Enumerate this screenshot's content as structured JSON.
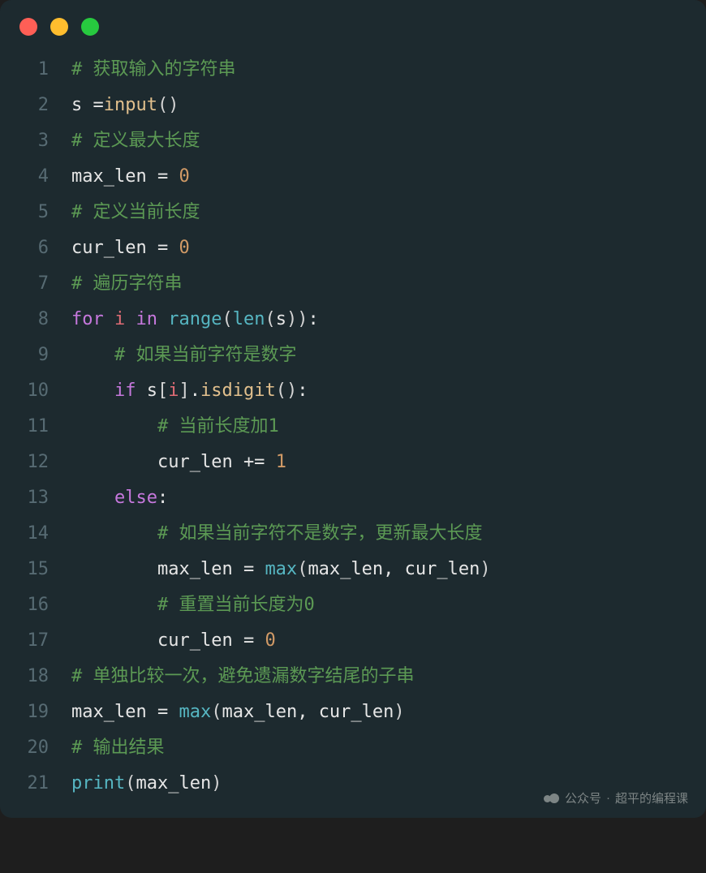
{
  "window": {
    "dots": [
      "red",
      "yellow",
      "green"
    ]
  },
  "watermark": {
    "prefix": "公众号",
    "dot": "·",
    "name": "超平的编程课"
  },
  "code": {
    "lines": [
      {
        "n": "1",
        "tokens": [
          {
            "t": "# 获取输入的字符串",
            "c": "c-comment"
          }
        ]
      },
      {
        "n": "2",
        "tokens": [
          {
            "t": "s ",
            "c": "c-ident"
          },
          {
            "t": "=",
            "c": "c-op"
          },
          {
            "t": "input",
            "c": "c-func"
          },
          {
            "t": "()",
            "c": "c-paren"
          }
        ]
      },
      {
        "n": "3",
        "tokens": [
          {
            "t": "# 定义最大长度",
            "c": "c-comment"
          }
        ]
      },
      {
        "n": "4",
        "tokens": [
          {
            "t": "max_len ",
            "c": "c-ident"
          },
          {
            "t": "= ",
            "c": "c-op"
          },
          {
            "t": "0",
            "c": "c-num"
          }
        ]
      },
      {
        "n": "5",
        "tokens": [
          {
            "t": "# 定义当前长度",
            "c": "c-comment"
          }
        ]
      },
      {
        "n": "6",
        "tokens": [
          {
            "t": "cur_len ",
            "c": "c-ident"
          },
          {
            "t": "= ",
            "c": "c-op"
          },
          {
            "t": "0",
            "c": "c-num"
          }
        ]
      },
      {
        "n": "7",
        "tokens": [
          {
            "t": "# 遍历字符串",
            "c": "c-comment"
          }
        ]
      },
      {
        "n": "8",
        "tokens": [
          {
            "t": "for ",
            "c": "c-kw"
          },
          {
            "t": "i ",
            "c": "c-var2"
          },
          {
            "t": "in ",
            "c": "c-kw"
          },
          {
            "t": "range",
            "c": "c-builtin"
          },
          {
            "t": "(",
            "c": "c-paren"
          },
          {
            "t": "len",
            "c": "c-builtin"
          },
          {
            "t": "(",
            "c": "c-paren"
          },
          {
            "t": "s",
            "c": "c-ident"
          },
          {
            "t": "))",
            "c": "c-paren"
          },
          {
            "t": ":",
            "c": "c-op"
          }
        ]
      },
      {
        "n": "9",
        "tokens": [
          {
            "t": "    ",
            "c": ""
          },
          {
            "t": "# 如果当前字符是数字",
            "c": "c-comment"
          }
        ]
      },
      {
        "n": "10",
        "tokens": [
          {
            "t": "    ",
            "c": ""
          },
          {
            "t": "if ",
            "c": "c-kw"
          },
          {
            "t": "s",
            "c": "c-ident"
          },
          {
            "t": "[",
            "c": "c-bracket"
          },
          {
            "t": "i",
            "c": "c-var2"
          },
          {
            "t": "]",
            "c": "c-bracket"
          },
          {
            "t": ".",
            "c": "c-dot"
          },
          {
            "t": "isdigit",
            "c": "c-func"
          },
          {
            "t": "()",
            "c": "c-paren"
          },
          {
            "t": ":",
            "c": "c-op"
          }
        ]
      },
      {
        "n": "11",
        "tokens": [
          {
            "t": "        ",
            "c": ""
          },
          {
            "t": "# 当前长度加1",
            "c": "c-comment"
          }
        ]
      },
      {
        "n": "12",
        "tokens": [
          {
            "t": "        ",
            "c": ""
          },
          {
            "t": "cur_len ",
            "c": "c-ident"
          },
          {
            "t": "+= ",
            "c": "c-op"
          },
          {
            "t": "1",
            "c": "c-num"
          }
        ]
      },
      {
        "n": "13",
        "tokens": [
          {
            "t": "    ",
            "c": ""
          },
          {
            "t": "else",
            "c": "c-kw"
          },
          {
            "t": ":",
            "c": "c-op"
          }
        ]
      },
      {
        "n": "14",
        "tokens": [
          {
            "t": "        ",
            "c": ""
          },
          {
            "t": "# 如果当前字符不是数字，更新最大长度",
            "c": "c-comment"
          }
        ]
      },
      {
        "n": "15",
        "tokens": [
          {
            "t": "        ",
            "c": ""
          },
          {
            "t": "max_len ",
            "c": "c-ident"
          },
          {
            "t": "= ",
            "c": "c-op"
          },
          {
            "t": "max",
            "c": "c-builtin"
          },
          {
            "t": "(",
            "c": "c-paren"
          },
          {
            "t": "max_len",
            "c": "c-ident"
          },
          {
            "t": ", ",
            "c": "c-op"
          },
          {
            "t": "cur_len",
            "c": "c-ident"
          },
          {
            "t": ")",
            "c": "c-paren"
          }
        ]
      },
      {
        "n": "16",
        "tokens": [
          {
            "t": "        ",
            "c": ""
          },
          {
            "t": "# 重置当前长度为0",
            "c": "c-comment"
          }
        ]
      },
      {
        "n": "17",
        "tokens": [
          {
            "t": "        ",
            "c": ""
          },
          {
            "t": "cur_len ",
            "c": "c-ident"
          },
          {
            "t": "= ",
            "c": "c-op"
          },
          {
            "t": "0",
            "c": "c-num"
          }
        ]
      },
      {
        "n": "18",
        "tokens": [
          {
            "t": "# 单独比较一次，避免遗漏数字结尾的子串",
            "c": "c-comment"
          }
        ]
      },
      {
        "n": "19",
        "tokens": [
          {
            "t": "max_len ",
            "c": "c-ident"
          },
          {
            "t": "= ",
            "c": "c-op"
          },
          {
            "t": "max",
            "c": "c-builtin"
          },
          {
            "t": "(",
            "c": "c-paren"
          },
          {
            "t": "max_len",
            "c": "c-ident"
          },
          {
            "t": ", ",
            "c": "c-op"
          },
          {
            "t": "cur_len",
            "c": "c-ident"
          },
          {
            "t": ")",
            "c": "c-paren"
          }
        ]
      },
      {
        "n": "20",
        "tokens": [
          {
            "t": "# 输出结果",
            "c": "c-comment"
          }
        ]
      },
      {
        "n": "21",
        "tokens": [
          {
            "t": "print",
            "c": "c-builtin"
          },
          {
            "t": "(",
            "c": "c-paren"
          },
          {
            "t": "max_len",
            "c": "c-ident"
          },
          {
            "t": ")",
            "c": "c-paren"
          }
        ]
      }
    ]
  }
}
